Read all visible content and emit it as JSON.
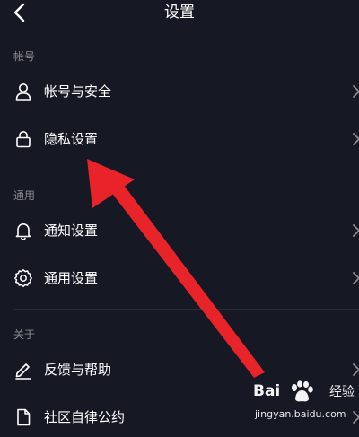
{
  "header": {
    "title": "设置",
    "back_icon": "chevron-left-icon"
  },
  "sections": [
    {
      "label": "帐号",
      "items": [
        {
          "label": "帐号与安全",
          "icon": "user-icon"
        },
        {
          "label": "隐私设置",
          "icon": "lock-icon"
        }
      ]
    },
    {
      "label": "通用",
      "items": [
        {
          "label": "通知设置",
          "icon": "bell-icon"
        },
        {
          "label": "通用设置",
          "icon": "gear-icon"
        }
      ]
    },
    {
      "label": "关于",
      "items": [
        {
          "label": "反馈与帮助",
          "icon": "pencil-icon"
        },
        {
          "label": "社区自律公约",
          "icon": "document-icon"
        }
      ]
    }
  ],
  "annotation": {
    "color": "#e8232a",
    "points_to": "隐私设置"
  },
  "watermark": {
    "brand": "Bai",
    "brand2": "经验",
    "url": "jingyan.baidu.com"
  },
  "colors": {
    "background": "#161823",
    "text": "#ffffff",
    "muted": "#8a8b91",
    "divider": "#2a2b33"
  }
}
